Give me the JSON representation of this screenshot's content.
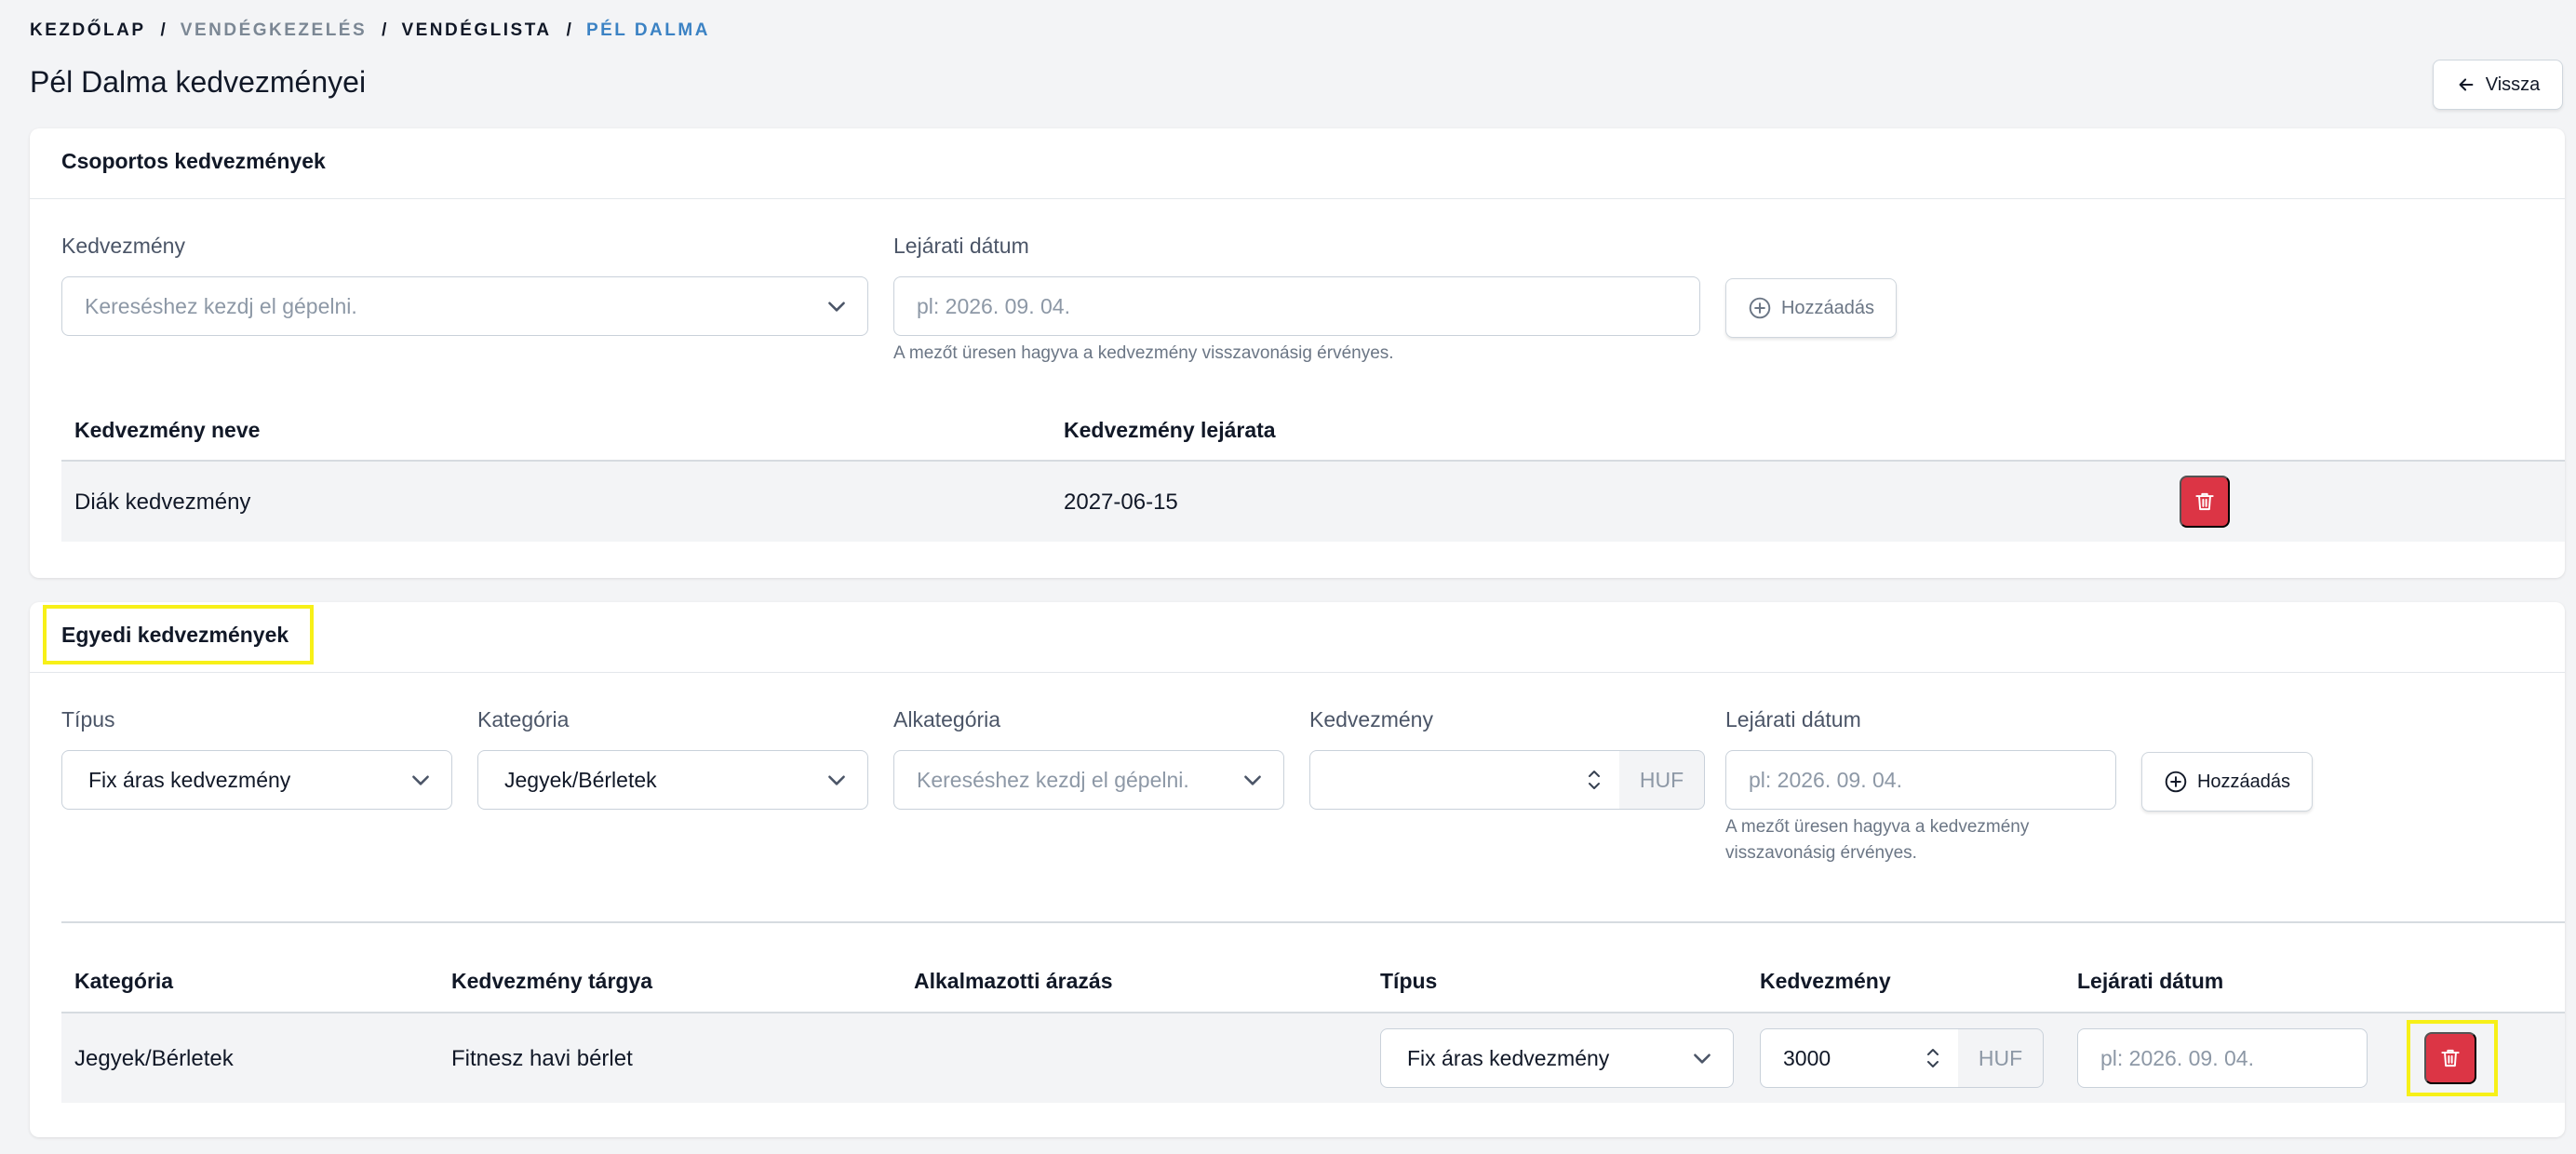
{
  "breadcrumb": {
    "items": [
      {
        "label": "Kezdőlap",
        "state": "normal"
      },
      {
        "label": "Vendégkezelés",
        "state": "muted"
      },
      {
        "label": "Vendéglista",
        "state": "normal"
      },
      {
        "label": "Pél Dalma",
        "state": "active"
      }
    ],
    "separator": "/"
  },
  "page": {
    "title": "Pél Dalma kedvezményei",
    "back_label": "Vissza"
  },
  "group": {
    "title": "Csoportos kedvezmények",
    "discount_label": "Kedvezmény",
    "discount_placeholder": "Kereséshez kezdj el gépelni.",
    "expiry_label": "Lejárati dátum",
    "expiry_placeholder": "pl: 2026. 09. 04.",
    "hint": "A mezőt üresen hagyva a kedvezmény visszavonásig érvényes.",
    "add_label": "Hozzáadás",
    "columns": [
      "Kedvezmény neve",
      "Kedvezmény lejárata"
    ],
    "rows": [
      {
        "name": "Diák kedvezmény",
        "expiry": "2027-06-15"
      }
    ]
  },
  "individual": {
    "title": "Egyedi kedvezmények",
    "type_label": "Típus",
    "type_value": "Fix áras kedvezmény",
    "category_label": "Kategória",
    "category_value": "Jegyek/Bérletek",
    "subcategory_label": "Alkategória",
    "subcategory_placeholder": "Kereséshez kezdj el gépelni.",
    "discount_label": "Kedvezmény",
    "discount_value": "",
    "currency": "HUF",
    "expiry_label": "Lejárati dátum",
    "expiry_placeholder": "pl: 2026. 09. 04.",
    "hint_line1": "A mezőt üresen hagyva a kedvezmény",
    "hint_line2": "visszavonásig érvényes.",
    "add_label": "Hozzáadás",
    "columns": [
      "Kategória",
      "Kedvezmény tárgya",
      "Alkalmazotti árazás",
      "Típus",
      "Kedvezmény",
      "Lejárati dátum"
    ],
    "rows": [
      {
        "category": "Jegyek/Bérletek",
        "subject": "Fitnesz havi bérlet",
        "employee_pricing": "",
        "type": "Fix áras kedvezmény",
        "discount": "3000",
        "currency": "HUF",
        "expiry_placeholder": "pl: 2026. 09. 04."
      }
    ]
  },
  "colors": {
    "accent_blue": "#3b82c4",
    "danger_red": "#dc3545",
    "highlight_yellow": "#f7f018"
  },
  "icons": {
    "back": "arrow-left-icon",
    "add": "plus-circle-icon",
    "delete": "trash-icon",
    "select": "chevron-down-icon",
    "stepper": "stepper-icon"
  }
}
